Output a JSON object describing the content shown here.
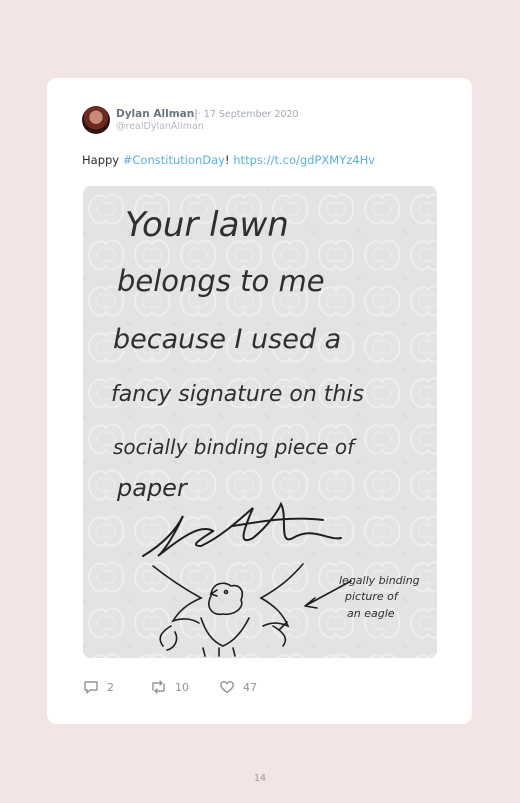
{
  "tweet": {
    "author_name": "Dylan Allman",
    "separator": "|",
    "date": "· 17 September 2020",
    "handle": "@realDylanAllman",
    "text_prefix": "Happy ",
    "hashtag": "#ConstitutionDay",
    "text_mid": "! ",
    "link": "https://t.co/gdPXMYz4Hv",
    "photo_lines": [
      "Your lawn",
      "belongs to me",
      "because I used a",
      "fancy signature on this",
      "socially binding piece of",
      "paper"
    ],
    "photo_annotation": [
      "legally binding",
      "picture of",
      "an eagle"
    ],
    "replies": "2",
    "retweets": "10",
    "likes": "47"
  },
  "page_number": "14"
}
